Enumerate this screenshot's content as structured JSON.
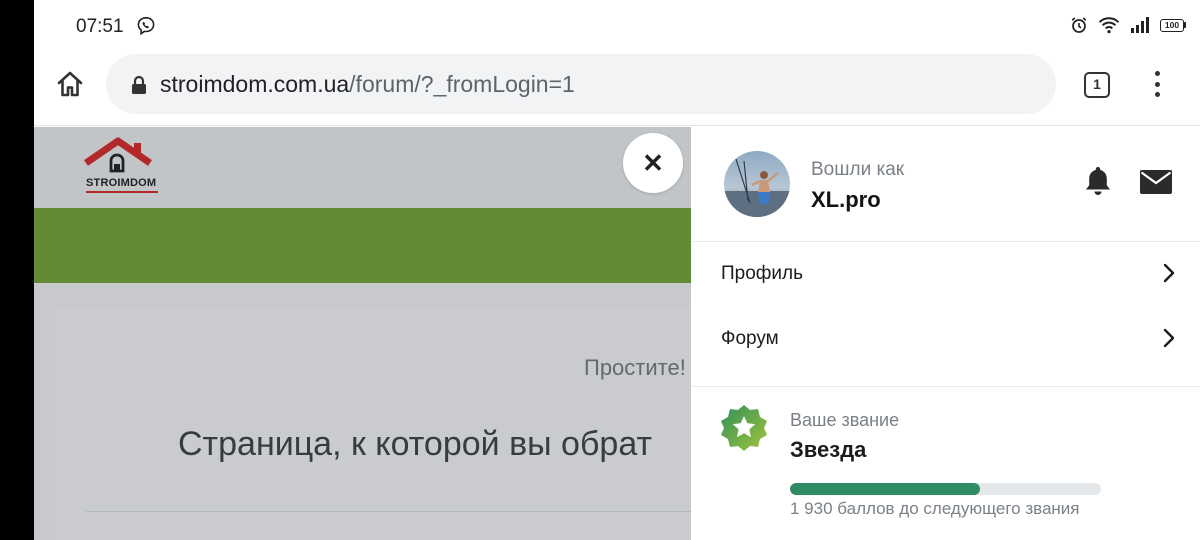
{
  "status_bar": {
    "time": "07:51",
    "battery": "100",
    "icons": [
      "viber-icon",
      "alarm-icon",
      "wifi-icon",
      "signal-icon",
      "battery-icon"
    ]
  },
  "browser": {
    "url_domain": "stroimdom.com.ua",
    "url_path": "/forum/?_fromLogin=1",
    "tab_count": "1"
  },
  "site": {
    "logo_text": "STROIMDOM",
    "colors": {
      "green_bar": "#6b9936",
      "logo_red": "#c62828"
    }
  },
  "error_card": {
    "sorry": "Простите!",
    "title": "Страница, к которой вы обрат"
  },
  "panel": {
    "logged_in_as_label": "Вошли как",
    "username": "XL.pro",
    "menu": [
      {
        "label": "Профиль"
      },
      {
        "label": "Форум"
      }
    ],
    "rank": {
      "label": "Ваше звание",
      "name": "Звезда",
      "progress_fraction": 0.61,
      "points_text": "1 930 баллов до следующего звания"
    },
    "colors": {
      "progress": "#2e8b63"
    }
  }
}
